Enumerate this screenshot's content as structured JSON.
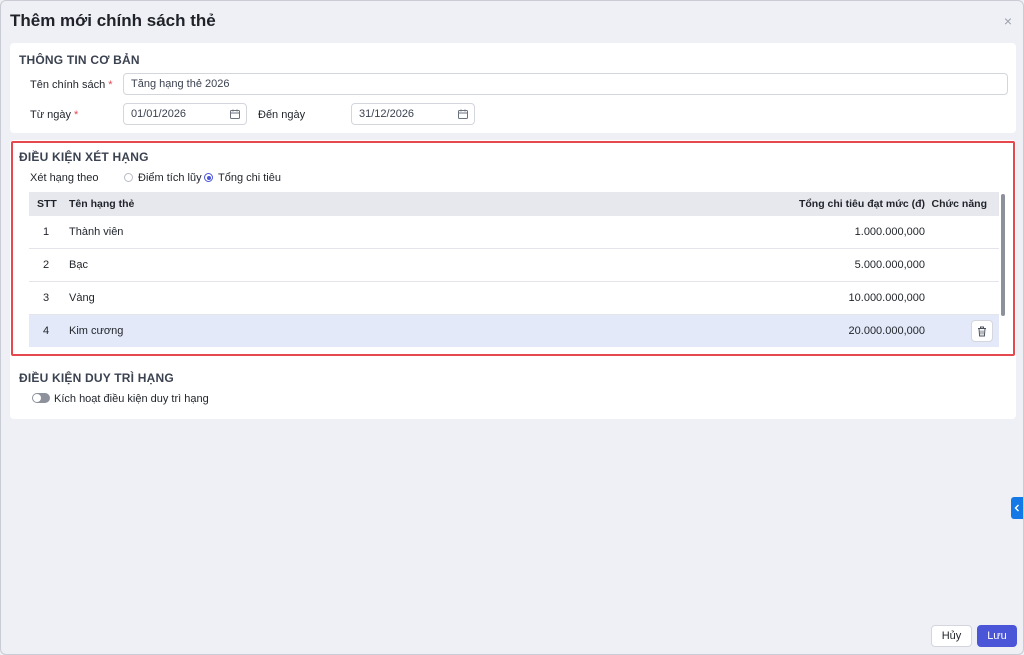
{
  "dialog": {
    "title": "Thêm mới chính sách thẻ",
    "close_label": "×"
  },
  "basic_info": {
    "section_title": "THÔNG TIN CƠ BẢN",
    "policy_name_label": "Tên chính sách",
    "policy_name_value": "Tăng hạng thẻ 2026",
    "from_date_label": "Từ ngày",
    "from_date_value": "01/01/2026",
    "to_date_label": "Đến ngày",
    "to_date_value": "31/12/2026",
    "required_mark": "*"
  },
  "ranking": {
    "section_title": "ĐIỀU KIỆN XÉT HẠNG",
    "rank_by_label": "Xét hạng theo",
    "options": [
      {
        "label": "Điểm tích lũy",
        "checked": false
      },
      {
        "label": "Tổng chi tiêu",
        "checked": true
      }
    ],
    "table": {
      "headers": {
        "stt": "STT",
        "name": "Tên hạng thẻ",
        "amount": "Tổng chi tiêu đạt mức (đ)",
        "actions": "Chức năng"
      },
      "rows": [
        {
          "stt": "1",
          "name": "Thành viên",
          "amount": "1.000.000,000"
        },
        {
          "stt": "2",
          "name": "Bạc",
          "amount": "5.000.000,000"
        },
        {
          "stt": "3",
          "name": "Vàng",
          "amount": "10.000.000,000"
        },
        {
          "stt": "4",
          "name": "Kim cương",
          "amount": "20.000.000,000"
        }
      ]
    }
  },
  "maintain": {
    "section_title": "ĐIỀU KIỆN DUY TRÌ HẠNG",
    "toggle_label": "Kích hoạt điều kiện duy trì hạng",
    "toggle_on": false
  },
  "footer": {
    "cancel_label": "Hủy",
    "save_label": "Lưu"
  },
  "colors": {
    "accent": "#4a55d8",
    "highlight_border": "#e5484d",
    "side_tab": "#1479e6"
  }
}
